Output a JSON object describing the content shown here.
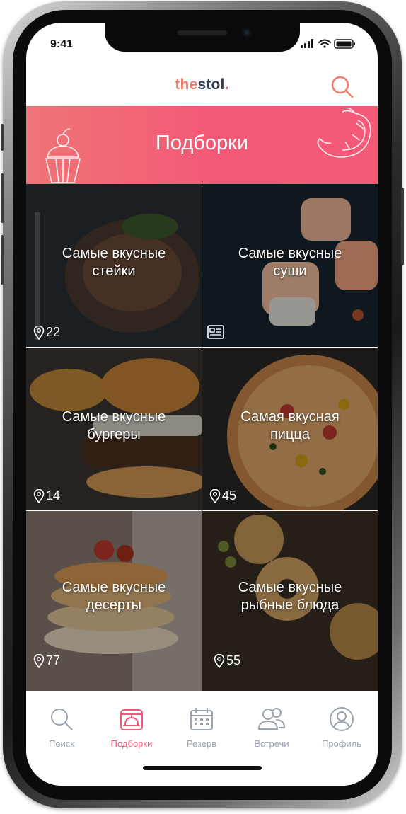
{
  "status_bar": {
    "time": "9:41"
  },
  "header": {
    "logo_part1": "the",
    "logo_part2": "stol",
    "logo_dot": "."
  },
  "banner": {
    "title": "Подборки"
  },
  "collections": [
    {
      "title_line1": "Самые вкусные",
      "title_line2": "стейки",
      "count": "22",
      "count_icon": "location-pin-icon"
    },
    {
      "title_line1": "Самые вкусные",
      "title_line2": "суши",
      "count": "",
      "count_icon": "list-icon"
    },
    {
      "title_line1": "Самые вкусные",
      "title_line2": "бургеры",
      "count": "14",
      "count_icon": "location-pin-icon"
    },
    {
      "title_line1": "Самая вкусная",
      "title_line2": "пицца",
      "count": "45",
      "count_icon": "location-pin-icon"
    },
    {
      "title_line1": "Самые вкусные",
      "title_line2": "десерты",
      "count": "77",
      "count_icon": "location-pin-icon"
    },
    {
      "title_line1": "Самые вкусные",
      "title_line2": "рыбные блюда",
      "count": "55",
      "count_icon": "location-pin-icon"
    }
  ],
  "tab_bar": {
    "active": "Подборки",
    "tabs": [
      {
        "label": "Поиск",
        "icon": "search-icon"
      },
      {
        "label": "Подборки",
        "icon": "dish-icon"
      },
      {
        "label": "Резерв",
        "icon": "calendar-icon"
      },
      {
        "label": "Встречи",
        "icon": "people-icon"
      },
      {
        "label": "Профиль",
        "icon": "profile-icon"
      }
    ]
  },
  "colors": {
    "accent": "#f05a78",
    "logo_orange": "#f07a66",
    "logo_navy": "#2c3e50",
    "tab_inactive": "#9aa3ae"
  }
}
